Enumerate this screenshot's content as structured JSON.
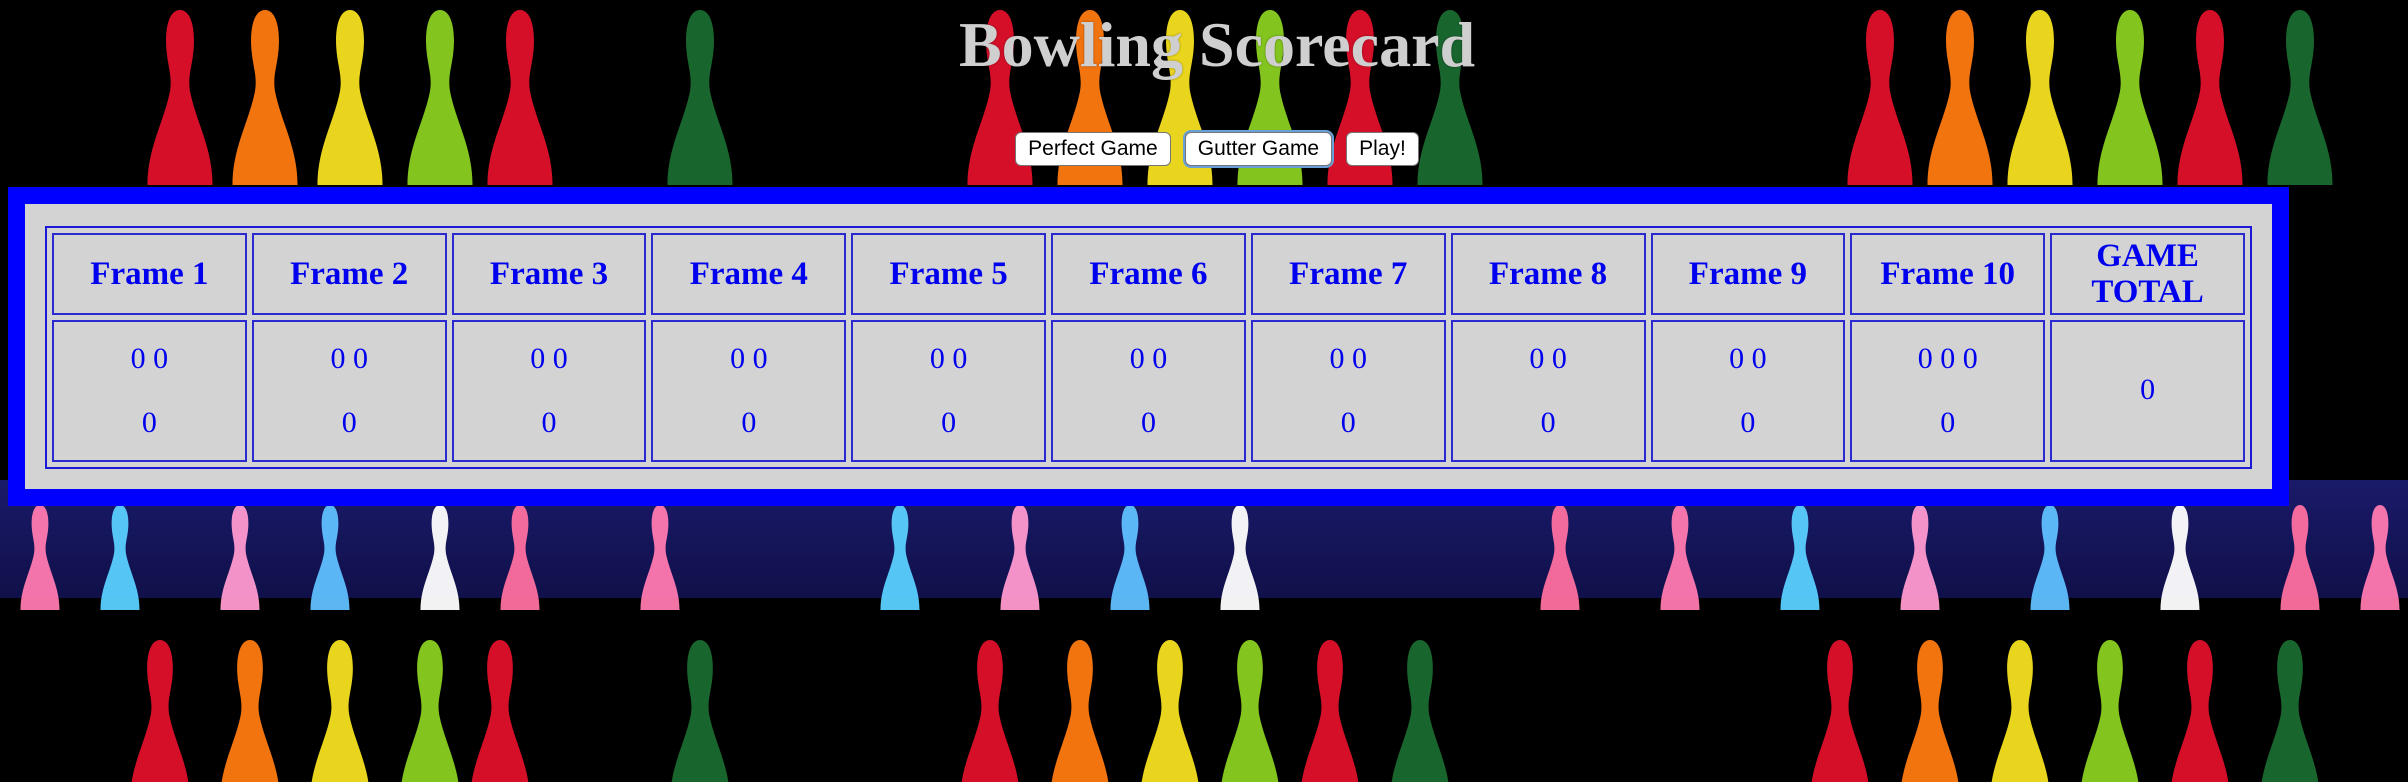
{
  "page": {
    "title": "Bowling Scorecard"
  },
  "buttons": {
    "perfect_label": "Perfect Game",
    "gutter_label": "Gutter Game",
    "play_label": "Play!"
  },
  "scorecard": {
    "frames": [
      {
        "label": "Frame 1",
        "rolls": "0 0",
        "total": "0"
      },
      {
        "label": "Frame 2",
        "rolls": "0 0",
        "total": "0"
      },
      {
        "label": "Frame 3",
        "rolls": "0 0",
        "total": "0"
      },
      {
        "label": "Frame 4",
        "rolls": "0 0",
        "total": "0"
      },
      {
        "label": "Frame 5",
        "rolls": "0 0",
        "total": "0"
      },
      {
        "label": "Frame 6",
        "rolls": "0 0",
        "total": "0"
      },
      {
        "label": "Frame 7",
        "rolls": "0 0",
        "total": "0"
      },
      {
        "label": "Frame 8",
        "rolls": "0 0",
        "total": "0"
      },
      {
        "label": "Frame 9",
        "rolls": "0 0",
        "total": "0"
      },
      {
        "label": "Frame 10",
        "rolls": "0 0 0",
        "total": "0"
      }
    ],
    "game_total_label": "GAME TOTAL",
    "game_total_value": "0"
  },
  "colors": {
    "board_border": "#0000ff",
    "board_fill": "#d3d3d3",
    "text": "#0000ee",
    "title": "#cfcfcf"
  },
  "icons": {
    "background": "bowling-pins-background-image"
  }
}
